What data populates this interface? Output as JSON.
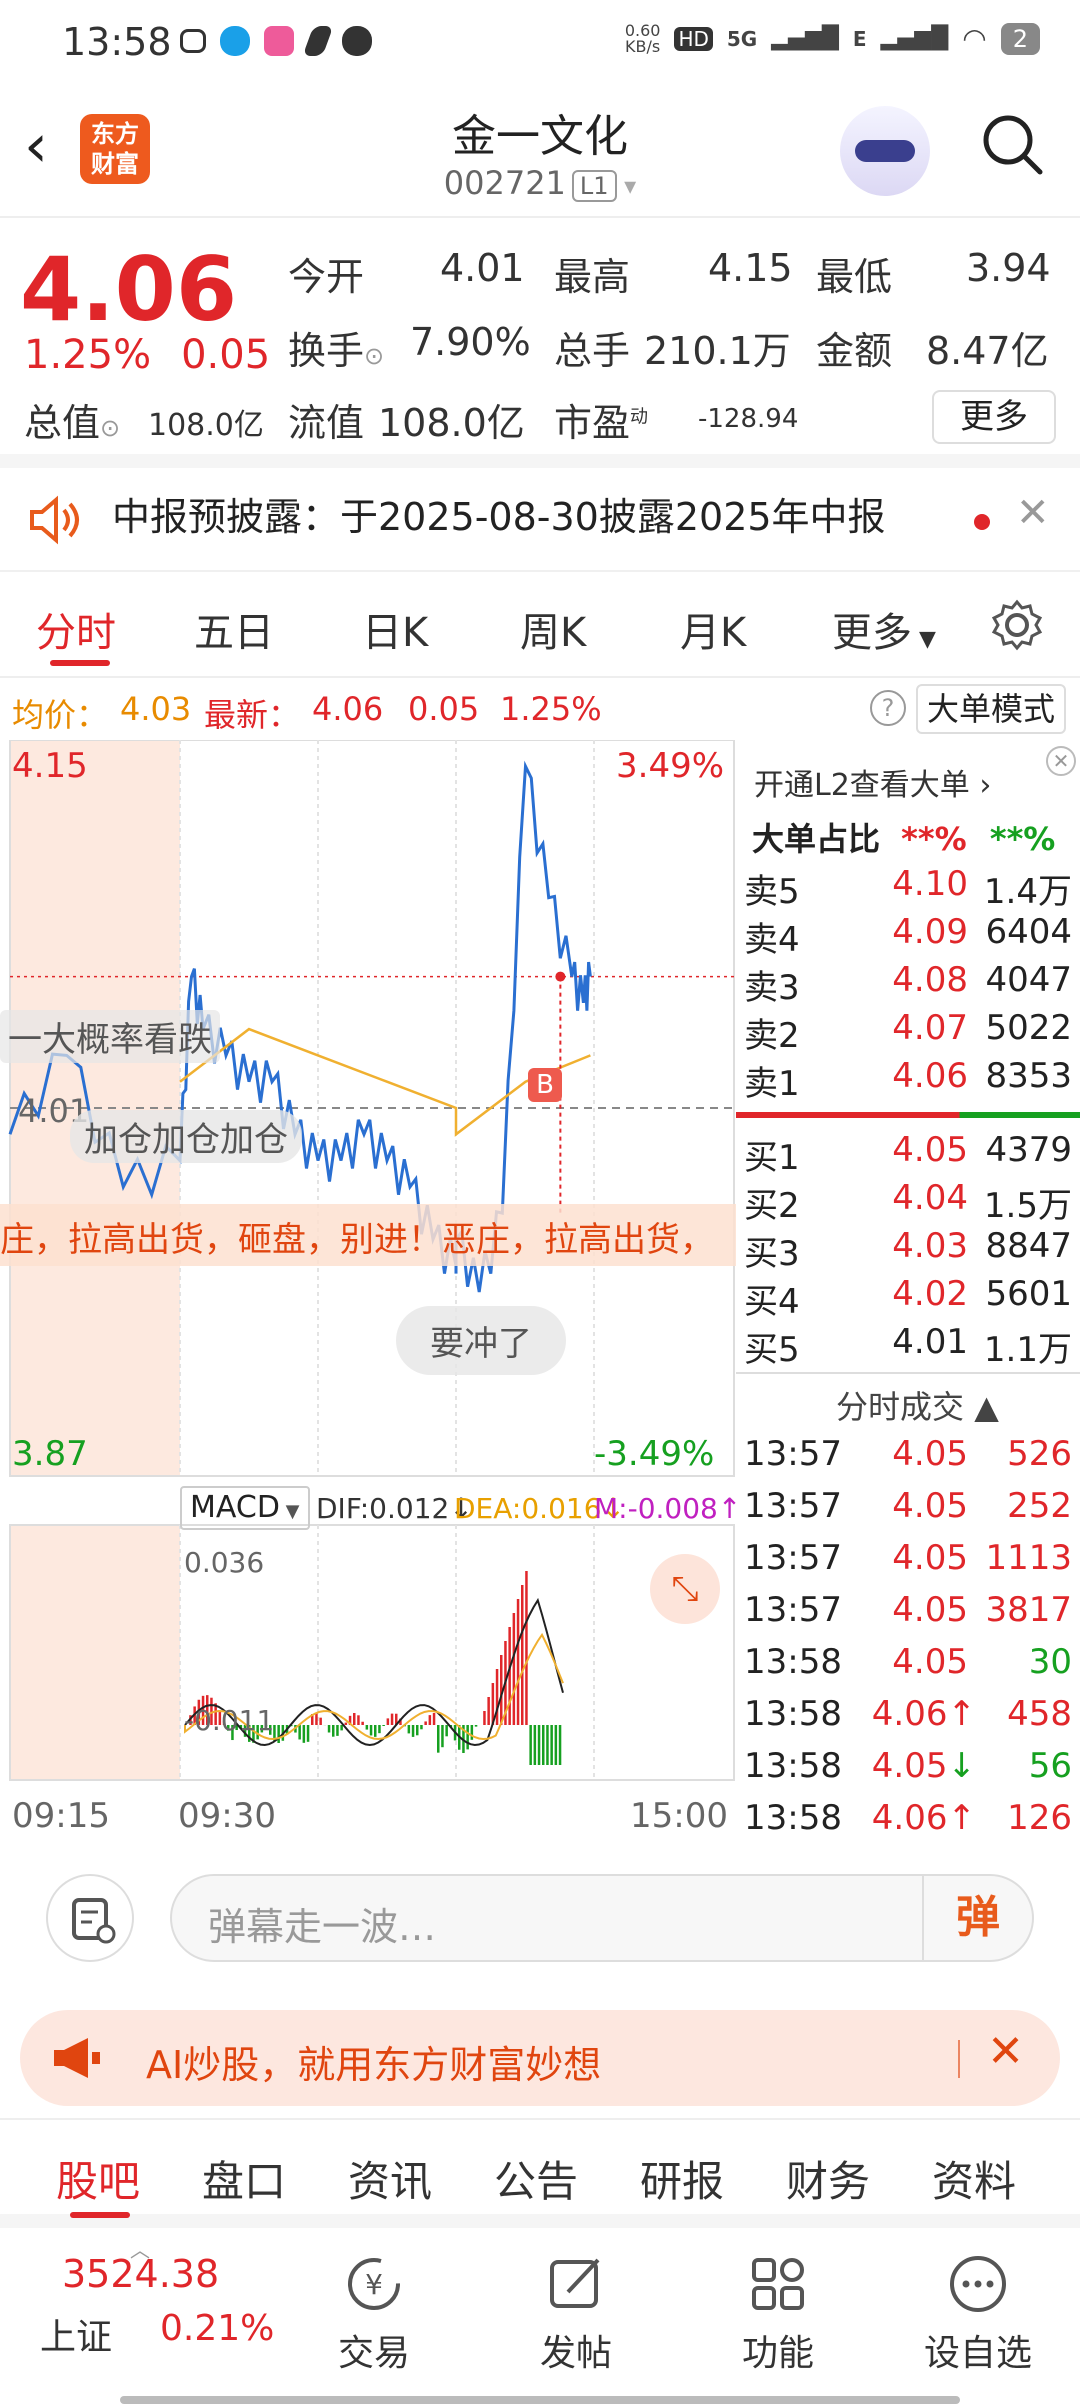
{
  "status": {
    "time": "13:58",
    "net_speed": "0.60\nKB/s",
    "net_top": "0.60",
    "net_bottom": "KB/s",
    "hd": "HD",
    "sig1": "5G",
    "sig2": "E",
    "battery": "2"
  },
  "header": {
    "title": "金一文化",
    "code": "002721",
    "level": "L1",
    "logo_top": "东方",
    "logo_bottom": "财富"
  },
  "quote": {
    "price": "4.06",
    "change_pct": "1.25%",
    "change_abs": "0.05",
    "labels": {
      "open": "今开",
      "high": "最高",
      "low": "最低",
      "turnover": "换手",
      "volume": "总手",
      "amount": "金额",
      "mcap": "总值",
      "float_cap": "流值",
      "pe": "市盈"
    },
    "values": {
      "open": "4.01",
      "high": "4.15",
      "low": "3.94",
      "turnover": "7.90%",
      "volume": "210.1万",
      "amount": "8.47亿",
      "mcap": "108.0亿",
      "float_cap": "108.0亿",
      "pe": "-128.94"
    },
    "pe_sup": "动",
    "more": "更多"
  },
  "notice": {
    "text": "中报预披露：于2025-08-30披露2025年中报"
  },
  "tabs": [
    "分时",
    "五日",
    "日K",
    "周K",
    "月K",
    "更多"
  ],
  "info": {
    "avg_label": "均价：",
    "avg": "4.03",
    "last_label": "最新：",
    "last": "4.06",
    "chg": "0.05",
    "pct": "1.25%",
    "mode": "大单模式",
    "q": "?"
  },
  "chart": {
    "top_price": "4.15",
    "top_pct": "3.49%",
    "bottom_price": "3.87",
    "bottom_pct": "-3.49%",
    "mid_price": "4.01",
    "danmaku": [
      "一大概率看跌",
      "加仓加仓加仓",
      "庄，拉高出货，砸盘，别进！恶庄，拉高出货，",
      "要冲了"
    ],
    "marker": "B",
    "macd": {
      "label": "MACD",
      "dif": "DIF:0.012",
      "dea": "DEA:0.016",
      "m": "M:-0.008",
      "top": "0.036",
      "bottom": "-0.011"
    },
    "times": [
      "09:15",
      "09:30",
      "15:00"
    ],
    "colors": {
      "price_line": "#2a6fd1",
      "avg_line": "#f0b030",
      "up": "#e0262a",
      "down": "#16a020"
    }
  },
  "chart_data": {
    "type": "line",
    "title": "",
    "series": [
      {
        "name": "",
        "x": [
          "09:15",
          "09:20",
          "09:25",
          "09:30",
          "09:35",
          "09:40",
          "09:50",
          "10:00",
          "10:10",
          "10:20",
          "10:30",
          "10:40",
          "10:50",
          "11:00",
          "11:10",
          "11:20",
          "11:30",
          "13:00",
          "13:10",
          "13:20",
          "13:30",
          "13:40",
          "13:50",
          "13:55",
          "13:58"
        ],
        "values": [
          4.0,
          4.03,
          3.98,
          3.99,
          4.06,
          4.04,
          4.03,
          4.02,
          4.02,
          4.0,
          3.99,
          3.99,
          4.0,
          3.99,
          3.98,
          3.96,
          3.95,
          3.96,
          3.94,
          3.97,
          4.14,
          4.09,
          4.06,
          4.05,
          4.06
        ]
      },
      {
        "name": "",
        "x": [
          "09:30",
          "10:00",
          "10:30",
          "11:00",
          "11:30",
          "13:00",
          "13:30",
          "13:58"
        ],
        "values": [
          4.02,
          4.04,
          4.03,
          4.02,
          4.01,
          4.0,
          4.02,
          4.03
        ]
      }
    ],
    "ylim": [
      3.87,
      4.15
    ]
  },
  "orderbook": {
    "header": "开通L2查看大单",
    "share_label": "大单占比",
    "share_up": "**%",
    "share_down": "**%",
    "asks": [
      {
        "l": "卖5",
        "p": "4.10",
        "q": "1.4万"
      },
      {
        "l": "卖4",
        "p": "4.09",
        "q": "6404"
      },
      {
        "l": "卖3",
        "p": "4.08",
        "q": "4047"
      },
      {
        "l": "卖2",
        "p": "4.07",
        "q": "5022"
      },
      {
        "l": "卖1",
        "p": "4.06",
        "q": "8353"
      }
    ],
    "bids": [
      {
        "l": "买1",
        "p": "4.05",
        "q": "4379"
      },
      {
        "l": "买2",
        "p": "4.04",
        "q": "1.5万"
      },
      {
        "l": "买3",
        "p": "4.03",
        "q": "8847"
      },
      {
        "l": "买4",
        "p": "4.02",
        "q": "5601"
      },
      {
        "l": "买5",
        "p": "4.01",
        "q": "1.1万"
      }
    ],
    "ticks_title": "分时成交",
    "ticks": [
      {
        "t": "13:57",
        "p": "4.05",
        "q": "526",
        "dir": ""
      },
      {
        "t": "13:57",
        "p": "4.05",
        "q": "252",
        "dir": ""
      },
      {
        "t": "13:57",
        "p": "4.05",
        "q": "1113",
        "dir": ""
      },
      {
        "t": "13:57",
        "p": "4.05",
        "q": "3817",
        "dir": ""
      },
      {
        "t": "13:58",
        "p": "4.05",
        "q": "30",
        "dir": ""
      },
      {
        "t": "13:58",
        "p": "4.06↑",
        "q": "458",
        "dir": ""
      },
      {
        "t": "13:58",
        "p": "4.05↓",
        "q": "56",
        "dir": ""
      },
      {
        "t": "13:58",
        "p": "4.06↑",
        "q": "126",
        "dir": ""
      }
    ]
  },
  "comment": {
    "placeholder": "弹幕走一波…",
    "dan": "弹"
  },
  "ai": {
    "text": "AI炒股，就用东方财富妙想"
  },
  "btabs": [
    "股吧",
    "盘口",
    "资讯",
    "公告",
    "研报",
    "财务",
    "资料"
  ],
  "nav": {
    "index_value": "3524.38",
    "index_name": "上证",
    "index_pct": "0.21%",
    "items": [
      "交易",
      "发帖",
      "功能",
      "设自选"
    ]
  }
}
